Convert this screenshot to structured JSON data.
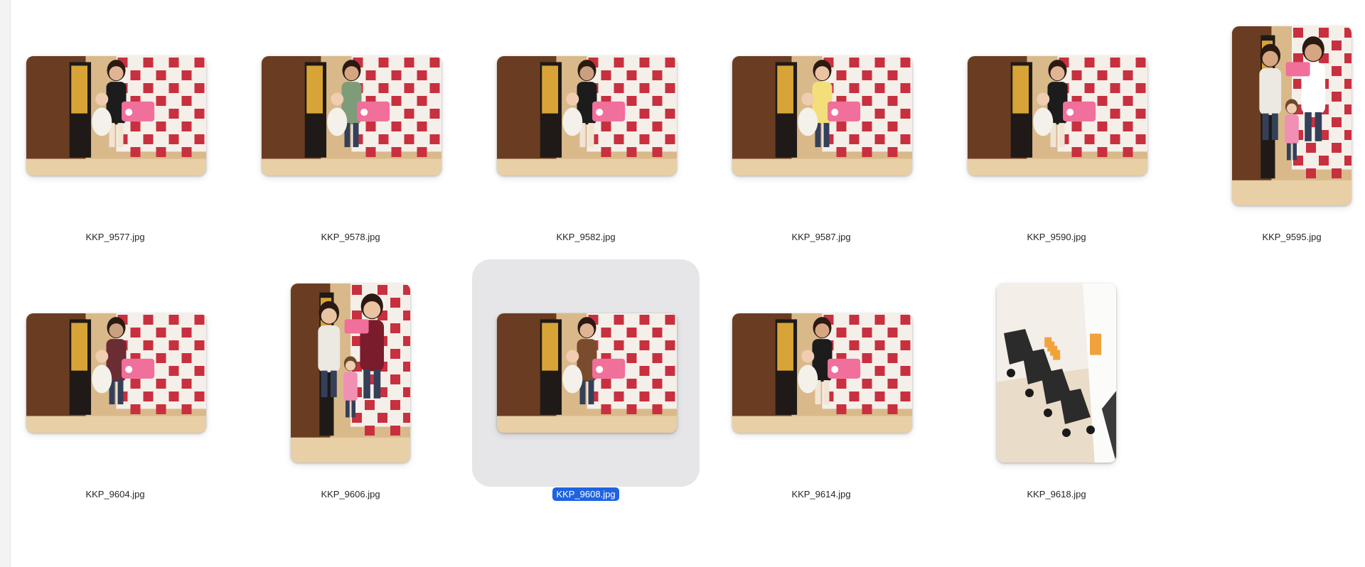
{
  "files": [
    {
      "name": "KKP_9577.jpg",
      "orientation": "landscape",
      "selected": false
    },
    {
      "name": "KKP_9578.jpg",
      "orientation": "landscape",
      "selected": false
    },
    {
      "name": "KKP_9582.jpg",
      "orientation": "landscape",
      "selected": false
    },
    {
      "name": "KKP_9587.jpg",
      "orientation": "landscape",
      "selected": false
    },
    {
      "name": "KKP_9590.jpg",
      "orientation": "landscape",
      "selected": false
    },
    {
      "name": "KKP_9595.jpg",
      "orientation": "portrait",
      "selected": false
    },
    {
      "name": "KKP_9604.jpg",
      "orientation": "landscape",
      "selected": false
    },
    {
      "name": "KKP_9606.jpg",
      "orientation": "portrait",
      "selected": false
    },
    {
      "name": "KKP_9608.jpg",
      "orientation": "landscape",
      "selected": true
    },
    {
      "name": "KKP_9614.jpg",
      "orientation": "landscape",
      "selected": false
    },
    {
      "name": "KKP_9618.jpg",
      "orientation": "portrait",
      "selected": false
    }
  ],
  "colors": {
    "selection_bg": "#e6e6e8",
    "selection_label": "#1f63e0",
    "photo_red": "#c8303f",
    "photo_wood": "#6a3d22",
    "photo_floor": "#d9b98a"
  }
}
